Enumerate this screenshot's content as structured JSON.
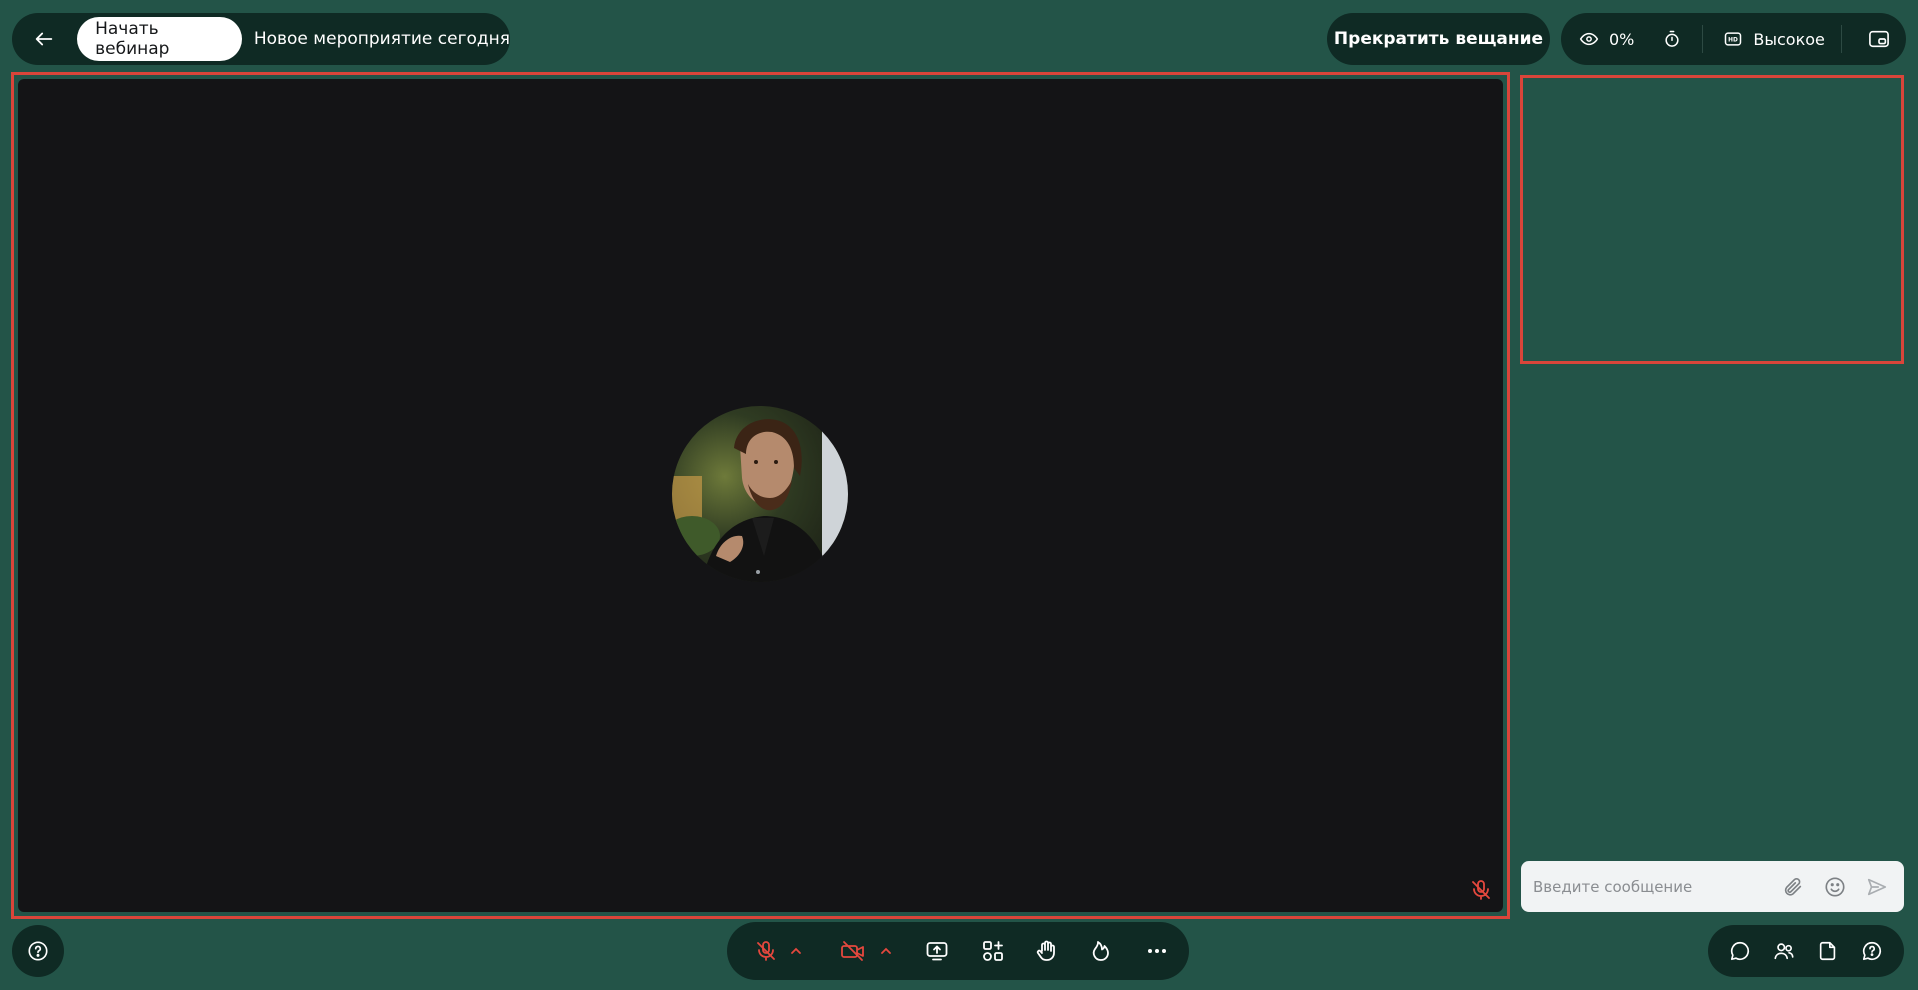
{
  "header": {
    "start_label": "Начать вебинар",
    "event_title": "Новое мероприятие сегодня",
    "stop_label": "Прекратить вещание",
    "viewers_percent": "0%",
    "quality_label": "Высокое"
  },
  "chat": {
    "placeholder": "Введите сообщение"
  },
  "icons": {
    "back": "arrow-left-icon",
    "viewers": "eye-icon",
    "timer": "stopwatch-icon",
    "quality": "hd-icon",
    "pip": "picture-in-picture-icon",
    "attach": "paperclip-icon",
    "emoji": "smile-icon",
    "send": "send-icon",
    "help": "question-icon",
    "mic": "mic-off-icon",
    "camera": "camera-off-icon",
    "screen": "screen-share-icon",
    "apps": "apps-add-icon",
    "hand": "raise-hand-icon",
    "reaction": "flame-icon",
    "more": "more-icon",
    "chat": "chat-icon",
    "participants": "users-icon",
    "files": "file-icon",
    "qa": "question-bubble-icon"
  },
  "colors": {
    "background": "#235448",
    "panel": "#0f2a24",
    "stage": "#141416",
    "highlight": "#d9453a",
    "muted": "#e5483e"
  }
}
